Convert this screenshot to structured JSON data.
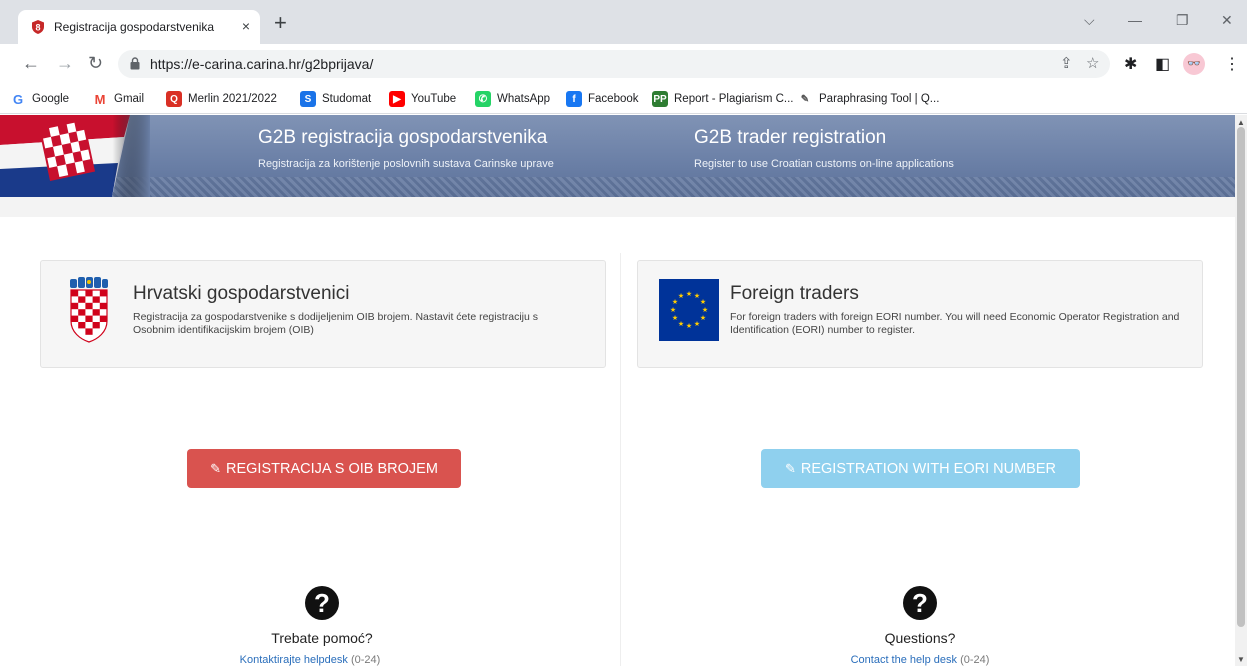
{
  "browser": {
    "tab_title": "Registracija gospodarstvenika",
    "tab_close": "×",
    "new_tab": "+",
    "url": "https://e-carina.carina.hr/g2bprijava/",
    "window_controls": {
      "chevron": "⌵",
      "minimize": "—",
      "restore": "❐",
      "close": "✕"
    }
  },
  "bookmarks": [
    {
      "label": "Google",
      "icon": "google-icon",
      "color": "#4285f4",
      "glyph": "G"
    },
    {
      "label": "Gmail",
      "icon": "gmail-icon",
      "color": "#ea4335",
      "glyph": "M"
    },
    {
      "label": "Merlin 2021/2022",
      "icon": "merlin-icon",
      "color": "#d93025",
      "glyph": "Q"
    },
    {
      "label": "Studomat",
      "icon": "studomat-icon",
      "color": "#1a73e8",
      "glyph": "S"
    },
    {
      "label": "YouTube",
      "icon": "youtube-icon",
      "color": "#ff0000",
      "glyph": "▶"
    },
    {
      "label": "WhatsApp",
      "icon": "whatsapp-icon",
      "color": "#25d366",
      "glyph": "✆"
    },
    {
      "label": "Facebook",
      "icon": "facebook-icon",
      "color": "#1877f2",
      "glyph": "f"
    },
    {
      "label": "Report - Plagiarism C...",
      "icon": "plagiarism-icon",
      "color": "#2e7d32",
      "glyph": "PP"
    },
    {
      "label": "Paraphrasing Tool | Q...",
      "icon": "quill-icon",
      "color": "#ffffff",
      "glyph": "✎"
    }
  ],
  "banner": {
    "hr_title": "G2B registracija gospodarstvenika",
    "hr_subtitle": "Registracija za korištenje poslovnih sustava Carinske uprave",
    "en_title": "G2B trader registration",
    "en_subtitle": "Register to use Croatian customs on-line applications"
  },
  "cards": {
    "croatian": {
      "title": "Hrvatski gospodarstvenici",
      "text": "Registracija za gospodarstvenike s dodijeljenim OIB brojem. Nastavit ćete registraciju s Osobnim identifikacijskim brojem (OIB)"
    },
    "foreign": {
      "title": "Foreign traders",
      "text": "For foreign traders with foreign EORI number. You will need Economic Operator Registration and Identification (EORI) number to register."
    }
  },
  "buttons": {
    "oib": {
      "label": "REGISTRACIJA S OIB BROJEM",
      "color": "#d9534f"
    },
    "eori": {
      "label": "REGISTRATION WITH EORI NUMBER",
      "color": "#8fd0ee"
    }
  },
  "help": {
    "hr": {
      "title": "Trebate pomoć?",
      "link": "Kontaktirajte helpdesk",
      "hours": "(0-24)"
    },
    "en": {
      "title": "Questions?",
      "link": "Contact the help desk",
      "hours": "(0-24)"
    }
  }
}
